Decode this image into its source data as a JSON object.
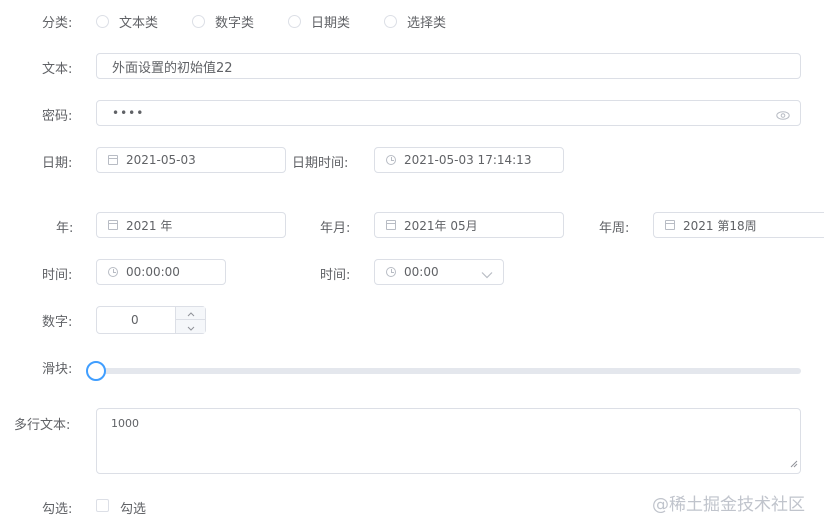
{
  "form": {
    "category": {
      "label": "分类:",
      "options": [
        "文本类",
        "数字类",
        "日期类",
        "选择类"
      ]
    },
    "text": {
      "label": "文本:",
      "value": "外面设置的初始值22"
    },
    "password": {
      "label": "密码:",
      "value": "••••"
    },
    "date": {
      "label": "日期:",
      "value": "2021-05-03"
    },
    "datetime": {
      "label": "日期时间:",
      "value": "2021-05-03 17:14:13"
    },
    "year": {
      "label": "年:",
      "value": "2021 年"
    },
    "month": {
      "label": "年月:",
      "value": "2021年 05月"
    },
    "week": {
      "label": "年周:",
      "value": "2021 第18周"
    },
    "time1": {
      "label": "时间:",
      "value": "00:00:00"
    },
    "time2": {
      "label": "时间:",
      "value": "00:00"
    },
    "number": {
      "label": "数字:",
      "value": "0"
    },
    "slider": {
      "label": "滑块:",
      "value": 0
    },
    "textarea": {
      "label": "多行文本:",
      "value": "1000"
    },
    "checkbox": {
      "label": "勾选:",
      "text": "勾选"
    }
  },
  "watermark": "@稀土掘金技术社区",
  "icons": {
    "eye": "eye-icon",
    "calendar": "calendar-icon",
    "clock": "clock-icon",
    "chevron": "chevron-down-icon",
    "up": "chevron-up-icon",
    "down": "chevron-down-icon"
  },
  "colors": {
    "accent": "#409eff",
    "border": "#dcdfe6",
    "text": "#606266"
  }
}
